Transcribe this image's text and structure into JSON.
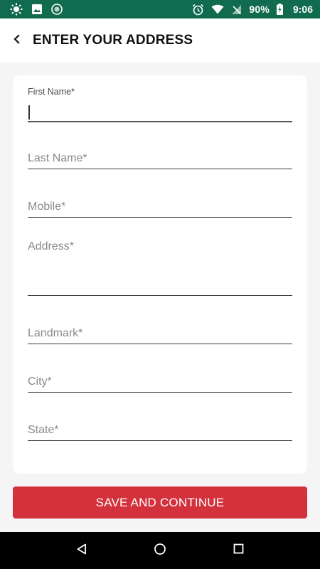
{
  "status_bar": {
    "battery_percent": "90%",
    "time": "9:06"
  },
  "header": {
    "title": "ENTER YOUR ADDRESS",
    "back_icon": "chevron-left-icon"
  },
  "form": {
    "fields": [
      {
        "key": "first_name",
        "label": "First Name*",
        "value": ""
      },
      {
        "key": "last_name",
        "label": "Last Name*",
        "value": ""
      },
      {
        "key": "mobile",
        "label": "Mobile*",
        "value": ""
      },
      {
        "key": "address",
        "label": "Address*",
        "value": ""
      },
      {
        "key": "landmark",
        "label": "Landmark*",
        "value": ""
      },
      {
        "key": "city",
        "label": "City*",
        "value": ""
      },
      {
        "key": "state",
        "label": "State*",
        "value": ""
      }
    ]
  },
  "actions": {
    "save_label": "SAVE AND CONTINUE"
  },
  "colors": {
    "status_bar": "#116b4f",
    "accent": "#d3323d",
    "background": "#f5f5f5",
    "card": "#ffffff"
  }
}
